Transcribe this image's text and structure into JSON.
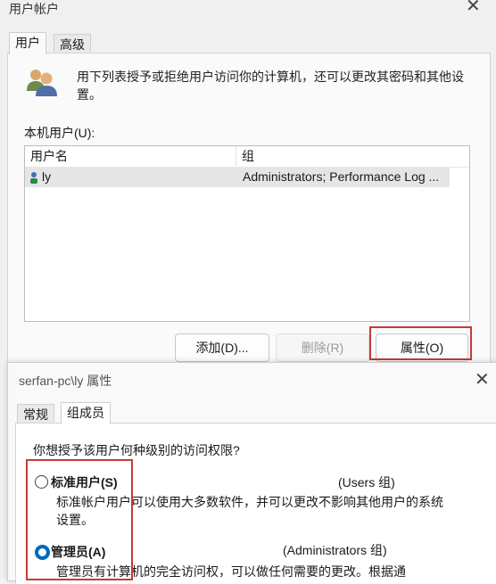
{
  "dialog1": {
    "title": "用户帐户",
    "tabs": [
      "用户",
      "高级"
    ],
    "description": "用下列表授予或拒绝用户访问你的计算机，还可以更改其密码和其他设置。",
    "local_users_label": "本机用户(U):",
    "columns": [
      "用户名",
      "组"
    ],
    "rows": [
      {
        "user": "ly",
        "group": "Administrators; Performance Log ..."
      }
    ],
    "buttons": {
      "add": "添加(D)...",
      "remove": "删除(R)",
      "properties": "属性(O)"
    }
  },
  "dialog2": {
    "title": "serfan-pc\\ly 属性",
    "tabs": [
      "常规",
      "组成员"
    ],
    "question": "你想授予该用户何种级别的访问权限?",
    "options": [
      {
        "label": "标准用户(S)",
        "group": "(Users 组)",
        "description": "标准帐户用户可以使用大多数软件，并可以更改不影响其他用户的系统设置。",
        "checked": false
      },
      {
        "label": "管理员(A)",
        "group": "(Administrators 组)",
        "description": "管理员有计算机的完全访问权，可以做任何需要的更改。根据通",
        "checked": true
      }
    ]
  },
  "colors": {
    "highlight": "#c63a3a",
    "accent": "#0067c0"
  },
  "icons": {
    "close": "close-icon",
    "users": "users-icon",
    "user_row": "user-icon"
  }
}
